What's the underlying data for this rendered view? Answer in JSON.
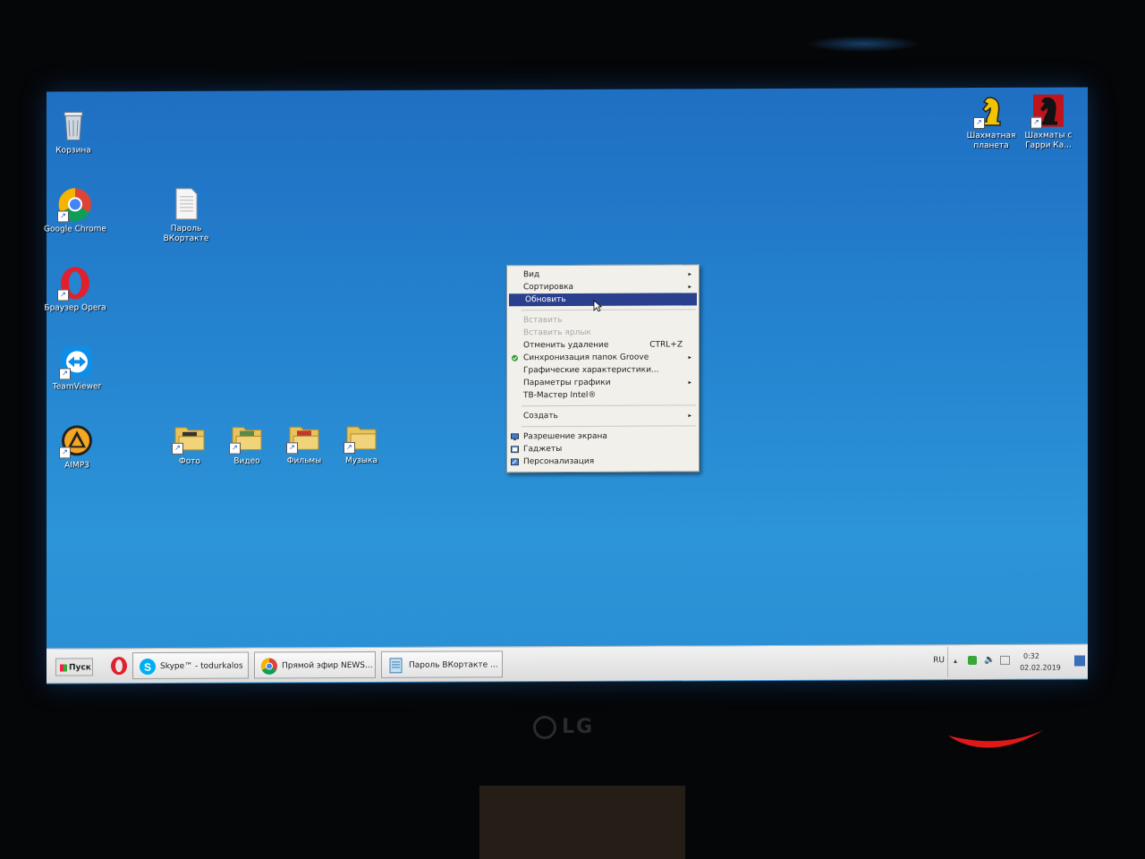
{
  "desktop": {
    "icons": [
      {
        "label": "Корзина",
        "icon": "recycle-bin-icon"
      },
      {
        "label": "Google Chrome",
        "icon": "chrome-icon"
      },
      {
        "label": "Пароль ВКортакте",
        "icon": "text-file-icon"
      },
      {
        "label": "Браузер Opera",
        "icon": "opera-icon"
      },
      {
        "label": "TeamViewer",
        "icon": "teamviewer-icon"
      },
      {
        "label": "AIMP3",
        "icon": "aimp-icon"
      },
      {
        "label": "Фото",
        "icon": "folder-icon"
      },
      {
        "label": "Видео",
        "icon": "folder-icon"
      },
      {
        "label": "Фильмы",
        "icon": "folder-icon"
      },
      {
        "label": "Музыка",
        "icon": "folder-icon"
      },
      {
        "label": "Шахматная планета",
        "icon": "chess-knight-icon"
      },
      {
        "label": "Шахматы с Гарри Ка...",
        "icon": "chess-knight-red-icon"
      }
    ]
  },
  "context_menu": {
    "items": [
      {
        "label": "Вид",
        "submenu": true
      },
      {
        "label": "Сортировка",
        "submenu": true
      },
      {
        "label": "Обновить",
        "highlighted": true
      },
      {
        "label": "Вставить",
        "disabled": true
      },
      {
        "label": "Вставить ярлык",
        "disabled": true
      },
      {
        "label": "Отменить удаление",
        "shortcut": "CTRL+Z"
      },
      {
        "label": "Синхронизация папок Groove",
        "submenu": true
      },
      {
        "label": "Графические характеристики..."
      },
      {
        "label": "Параметры графики",
        "submenu": true
      },
      {
        "label": "ТВ-Мастер Intel®"
      },
      {
        "label": "Создать",
        "submenu": true
      },
      {
        "label": "Разрешение экрана"
      },
      {
        "label": "Гаджеты"
      },
      {
        "label": "Персонализация"
      }
    ],
    "arrow": "▸"
  },
  "taskbar": {
    "start_label": "Пуск",
    "tasks": [
      {
        "label": "Skype™ - todurkalos",
        "icon": "skype-icon"
      },
      {
        "label": "Прямой эфир NEWS...",
        "icon": "chrome-icon"
      },
      {
        "label": "Пароль ВКортакте ...",
        "icon": "notepad-icon"
      }
    ],
    "lang": "RU",
    "time": "0:32",
    "date": "02.02.2019"
  },
  "monitor": {
    "brand": "LG"
  },
  "colors": {
    "desktop": "#2585d0",
    "menu_highlight": "#2b3f8f"
  }
}
